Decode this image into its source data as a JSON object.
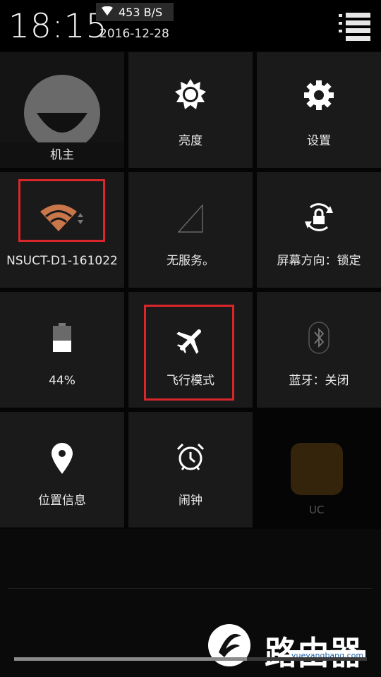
{
  "status": {
    "time": "18:15",
    "net_speed": "453 B/S",
    "date": "2016-12-28"
  },
  "tiles": {
    "user": {
      "label": "机主"
    },
    "brightness": {
      "label": "亮度"
    },
    "settings": {
      "label": "设置"
    },
    "wifi": {
      "label": "NSUCT-D1-161022"
    },
    "mobile": {
      "label": "无服务。"
    },
    "rotation": {
      "label": "屏幕方向：锁定"
    },
    "battery": {
      "label": "44%",
      "level_percent": 44
    },
    "airplane": {
      "label": "飞行模式"
    },
    "bluetooth": {
      "label": "蓝牙：关闭"
    },
    "location": {
      "label": "位置信息"
    },
    "alarm": {
      "label": "闹钟"
    }
  },
  "background": {
    "uc_label": "UC"
  },
  "brightness_bar": {
    "fill_fraction": 0.66
  },
  "watermark": {
    "text": "路由器",
    "site": "yueyangbang.com"
  },
  "colors": {
    "highlight": "#d8262b",
    "wifi_active": "#c8764a",
    "tile_bg": "#1a1a1a"
  }
}
